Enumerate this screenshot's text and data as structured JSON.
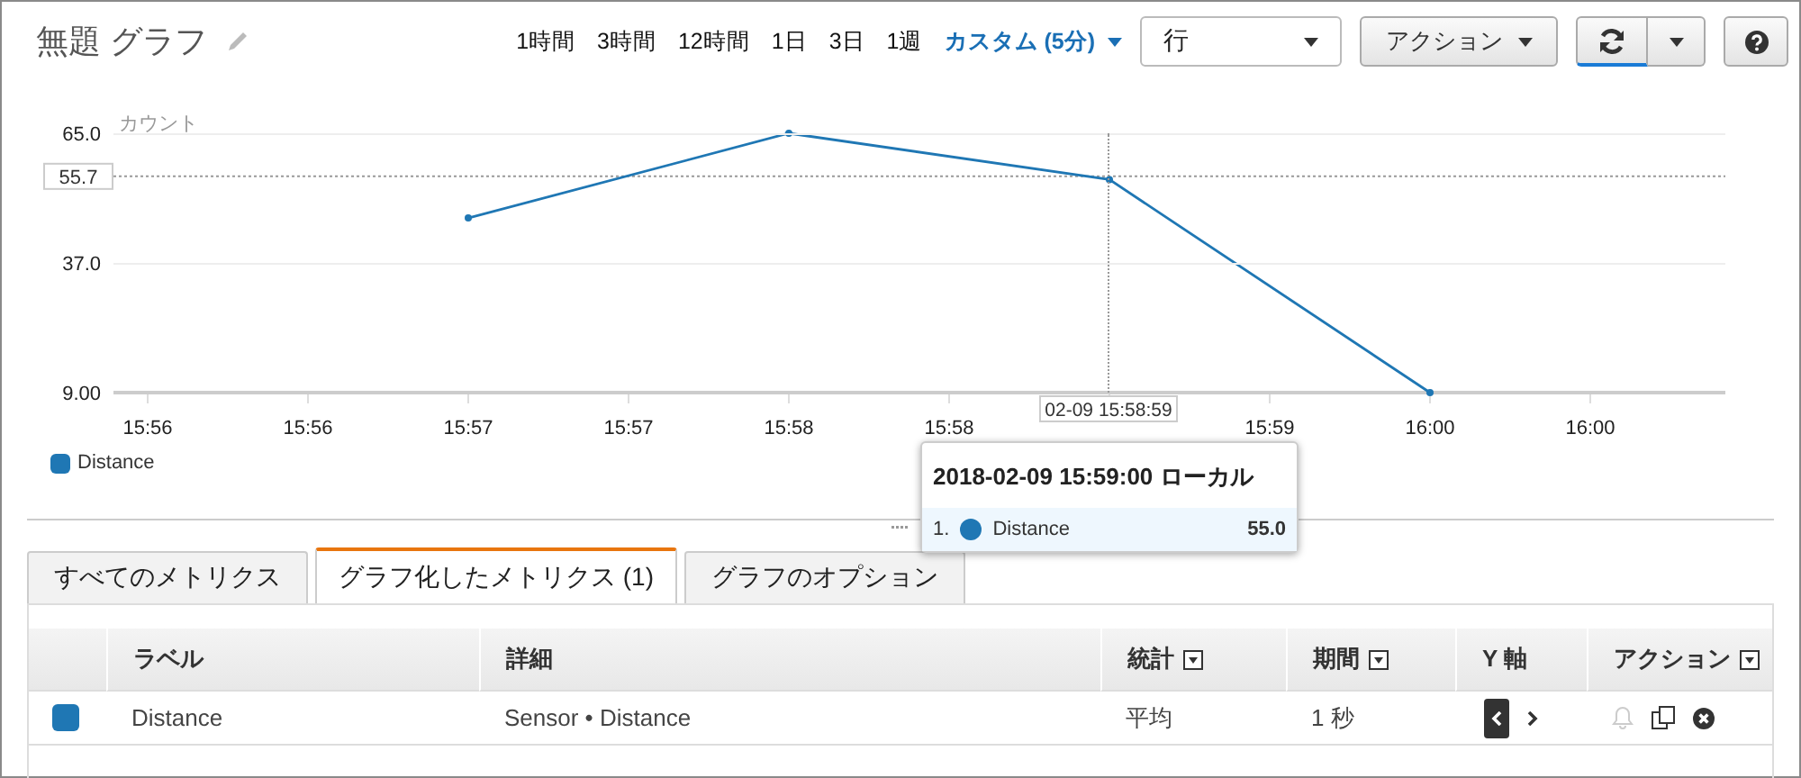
{
  "header": {
    "title": "無題 グラフ",
    "time_ranges": [
      {
        "label": "1時間",
        "selected": false
      },
      {
        "label": "3時間",
        "selected": false
      },
      {
        "label": "12時間",
        "selected": false
      },
      {
        "label": "1日",
        "selected": false
      },
      {
        "label": "3日",
        "selected": false
      },
      {
        "label": "1週",
        "selected": false
      },
      {
        "label": "カスタム (5分)",
        "selected": true
      }
    ],
    "view_select": {
      "value": "行"
    },
    "actions_button": "アクション"
  },
  "graph": {
    "chart_data": {
      "type": "line",
      "ylabel": "カウント",
      "categories": [
        "15:56",
        "15:56",
        "15:57",
        "15:57",
        "15:58",
        "15:58",
        null,
        "15:59",
        "16:00",
        "16:00"
      ],
      "series": [
        {
          "name": "Distance",
          "color": "#1f77b4",
          "marker": true,
          "values": [
            null,
            null,
            46.7,
            null,
            65,
            null,
            55,
            null,
            9,
            null
          ]
        }
      ],
      "ylim": [
        9,
        65
      ],
      "ref_lines": [
        {
          "axis": "y",
          "value": 55.7,
          "label": "55.7"
        }
      ],
      "yticks": [
        {
          "value": 9,
          "label": "9.00"
        },
        {
          "value": 37,
          "label": "37.0"
        },
        {
          "value": 65,
          "label": "65.0"
        }
      ]
    },
    "hover_time_label": "02-09 15:58:59",
    "tooltip": {
      "title": "2018-02-09 15:59:00 ローカル",
      "rows": [
        {
          "index": "1.",
          "name": "Distance",
          "value": "55.0",
          "color": "#1f77b4"
        }
      ]
    }
  },
  "tabs": [
    {
      "label": "すべてのメトリクス",
      "selected": false
    },
    {
      "label": "グラフ化したメトリクス (1)",
      "selected": true
    },
    {
      "label": "グラフのオプション",
      "selected": false
    }
  ],
  "table": {
    "columns": [
      {
        "label": "ラベル",
        "menu": false
      },
      {
        "label": "詳細",
        "menu": false
      },
      {
        "label": "統計",
        "menu": true
      },
      {
        "label": "期間",
        "menu": true
      },
      {
        "label": "Y 軸",
        "menu": false
      },
      {
        "label": "アクション",
        "menu": true
      }
    ],
    "rows": [
      {
        "color": "#1f77b4",
        "label": "Distance",
        "details": "Sensor • Distance",
        "statistic": "平均",
        "period": "1 秒",
        "y_axis_left": true,
        "alarm_disabled": true
      }
    ]
  }
}
